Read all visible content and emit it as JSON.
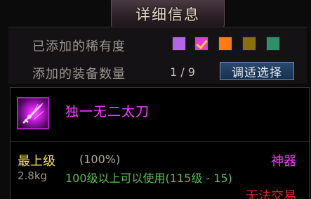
{
  "window": {
    "title": "详细信息"
  },
  "filter": {
    "rarity_label": "已添加的稀有度",
    "count_label": "添加的装备数量",
    "count_value": "1 / 9",
    "select_button_label": "调适选择",
    "swatches": [
      {
        "name": "purple",
        "color": "#b566e8",
        "checked": false
      },
      {
        "name": "magenta",
        "color": "#e23ad9",
        "checked": true
      },
      {
        "name": "orange",
        "color": "#ff7a12",
        "checked": false
      },
      {
        "name": "olive",
        "color": "#8a6f0c",
        "checked": false
      },
      {
        "name": "teal",
        "color": "#2f8f6a",
        "checked": false
      }
    ]
  },
  "item": {
    "name": "独一无二太刀",
    "icon": "katana-icon",
    "grade": "最上级",
    "grade_percent": "(100%)",
    "rarity": "神器",
    "weight": "2.8kg",
    "level_requirement": "100级以上可以使用(115级 - 15)",
    "trade_status": "无法交易"
  },
  "colors": {
    "item_name": "#ff3cff",
    "grade": "#f5e34b",
    "level_requirement": "#5fbf55",
    "trade_status": "#e0281f",
    "button_bg": "#1f3d5f"
  }
}
